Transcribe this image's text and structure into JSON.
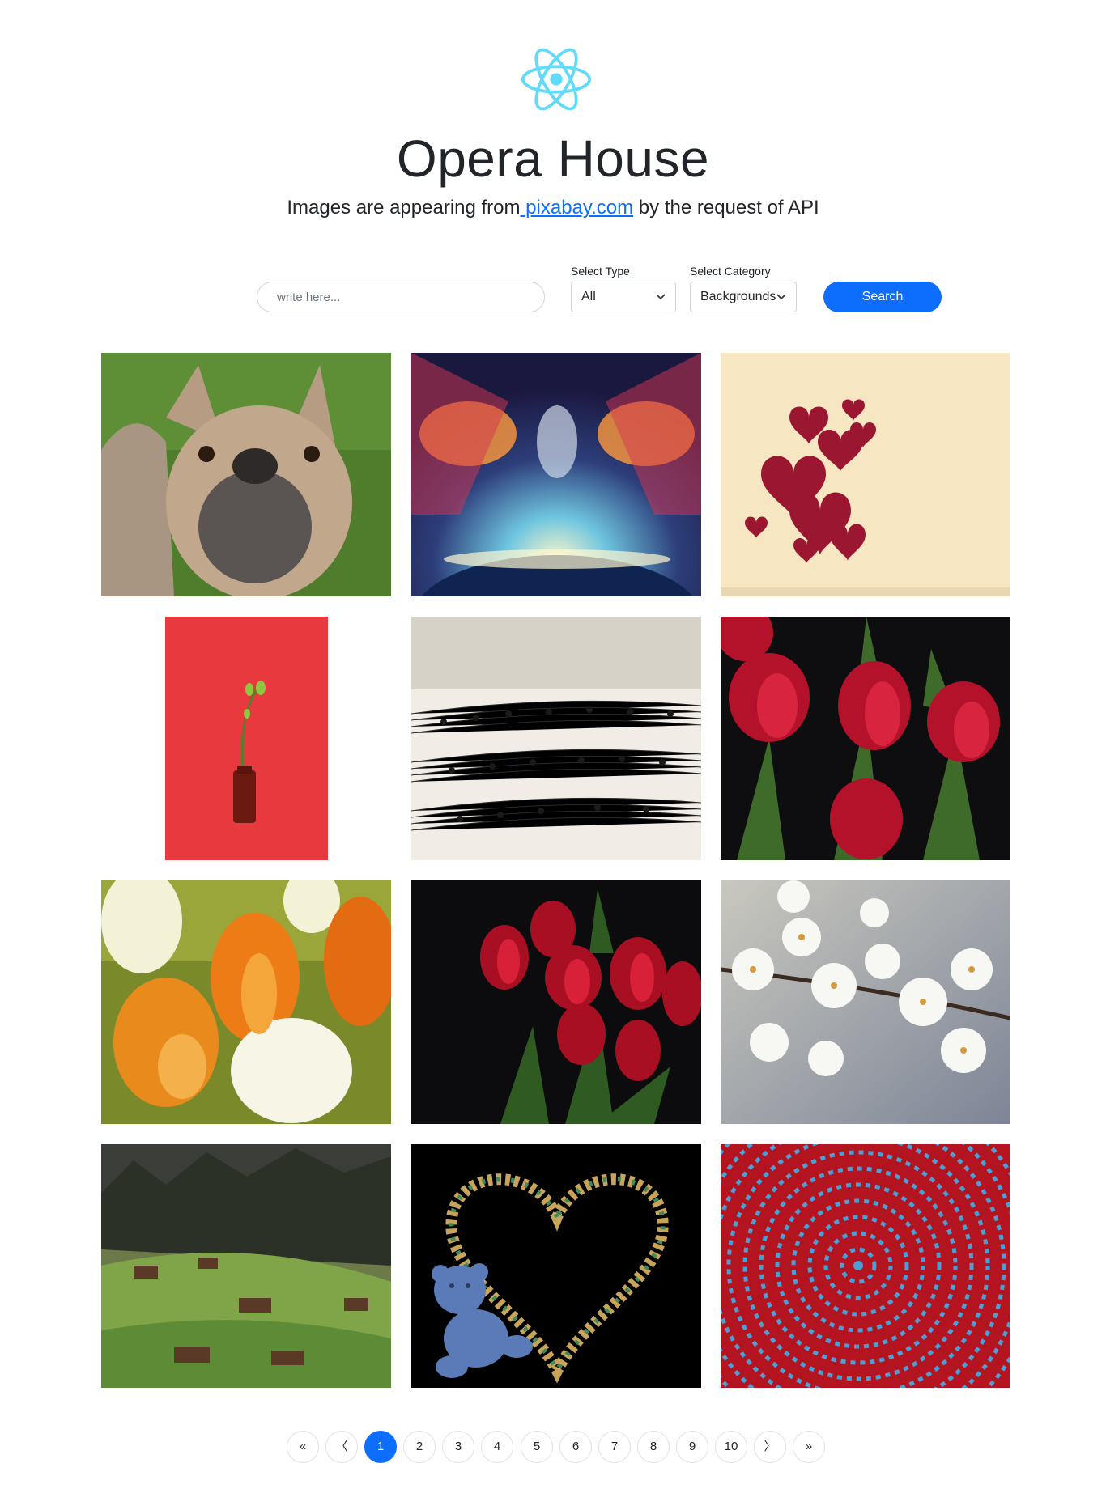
{
  "header": {
    "logo_icon": "react-atom-icon",
    "title": "Opera House",
    "subtitle_prefix": "Images are appearing from",
    "subtitle_link": " pixabay.com",
    "subtitle_suffix": " by the request of API"
  },
  "search": {
    "placeholder": "write here...",
    "value": "",
    "button_label": "Search"
  },
  "filters": {
    "type_label": "Select Type",
    "type_value": "All",
    "category_label": "Select Category",
    "category_value": "Backgrounds"
  },
  "gallery": [
    {
      "subject": "french-bulldog"
    },
    {
      "subject": "fantasy-space-portrait"
    },
    {
      "subject": "red-hearts-on-paper"
    },
    {
      "subject": "sprout-in-bottle"
    },
    {
      "subject": "sheet-music"
    },
    {
      "subject": "red-tulips-dark"
    },
    {
      "subject": "orange-white-tulips"
    },
    {
      "subject": "red-tulips-bouquet"
    },
    {
      "subject": "white-blossoms"
    },
    {
      "subject": "alpine-village"
    },
    {
      "subject": "teddy-bear-candle-heart"
    },
    {
      "subject": "spiral-at-pattern"
    }
  ],
  "pagination": {
    "first": "«",
    "prev": "〈",
    "pages": [
      "1",
      "2",
      "3",
      "4",
      "5",
      "6",
      "7",
      "8",
      "9",
      "10"
    ],
    "next": "〉",
    "last": "»",
    "current": "1"
  },
  "colors": {
    "accent": "#0d6efd",
    "react_logo": "#61dafb"
  }
}
